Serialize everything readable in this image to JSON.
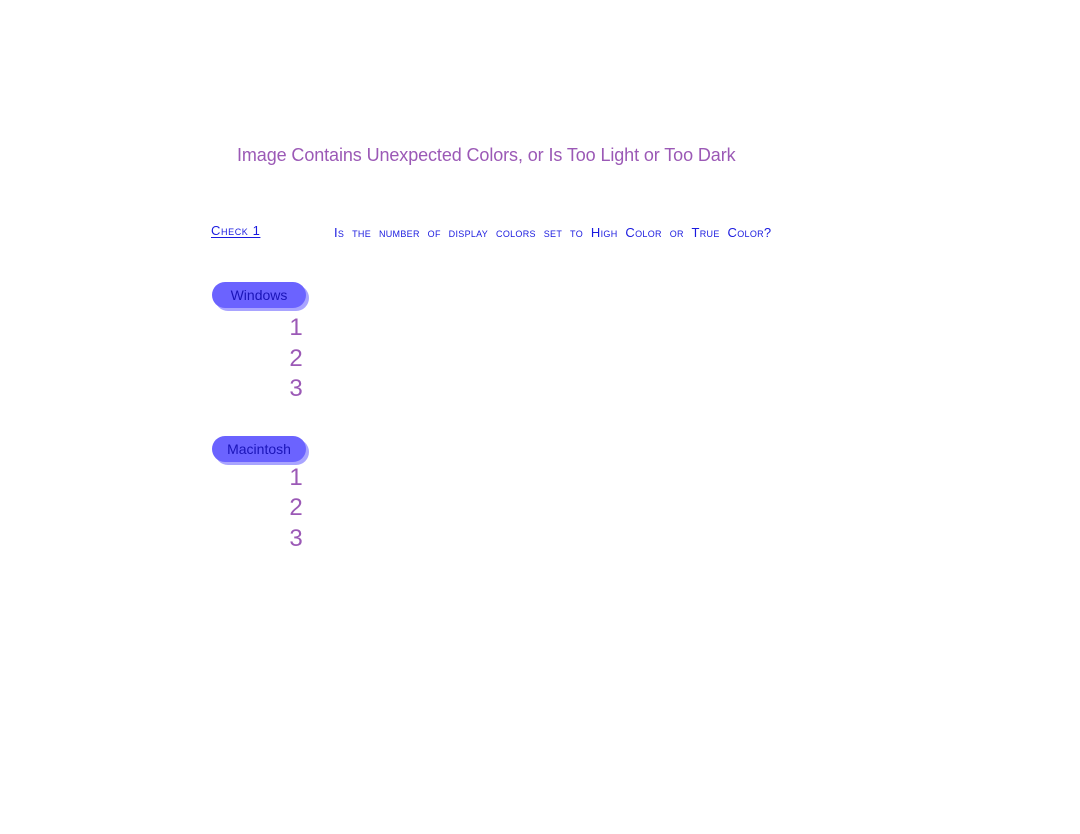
{
  "page": {
    "title": "Image Contains Unexpected Colors, or Is Too Light or Too Dark"
  },
  "check": {
    "label": "Check 1",
    "question": "Is the number  of display  colors set to High Color or True Color?"
  },
  "sections": [
    {
      "os_label": "Windows",
      "steps": [
        "1",
        "2",
        "3"
      ]
    },
    {
      "os_label": "Macintosh",
      "steps": [
        "1",
        "2",
        "3"
      ]
    }
  ],
  "colors": {
    "title": "#9b59b6",
    "check_text": "#1a1adf",
    "pill_bg": "#6b63ff",
    "pill_text": "#1a14b8"
  }
}
